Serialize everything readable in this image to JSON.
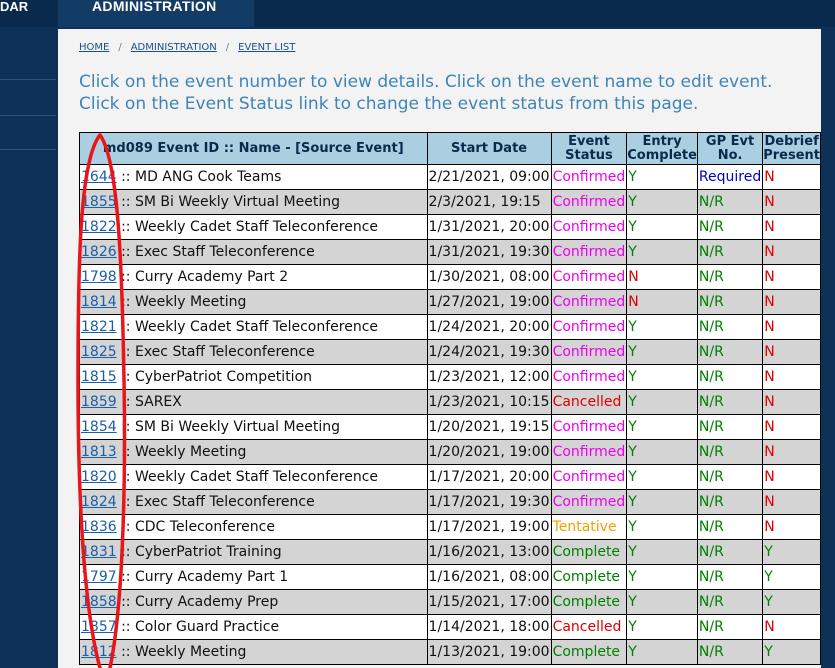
{
  "nav": {
    "item1": "DAR",
    "item2": "ADMINISTRATION"
  },
  "breadcrumb": {
    "home": "HOME",
    "sep": "/",
    "admin": "ADMINISTRATION",
    "list": "EVENT LIST"
  },
  "intro": "Click on the event number to view details. Click on the event name to edit event. Click on the Event Status link to change the event status from this page.",
  "table": {
    "headers": {
      "name": "md089 Event ID :: Name - [Source Event]",
      "start": "Start Date",
      "status_l1": "Event",
      "status_l2": "Status",
      "entry_l1": "Entry",
      "entry_l2": "Complete",
      "gp_l1": "GP Evt",
      "gp_l2": "No.",
      "debrief_l1": "Debrief",
      "debrief_l2": "Present"
    },
    "rows": [
      {
        "id": "1644",
        "name": "MD ANG Cook Teams",
        "start": "2/21/2021, 09:00",
        "status": "Confirmed",
        "entry": "Y",
        "gp": "Required",
        "debrief": "N"
      },
      {
        "id": "1855",
        "name": "SM Bi Weekly Virtual Meeting",
        "start": "2/3/2021, 19:15",
        "status": "Confirmed",
        "entry": "Y",
        "gp": "N/R",
        "debrief": "N"
      },
      {
        "id": "1822",
        "name": "Weekly Cadet Staff Teleconference",
        "start": "1/31/2021, 20:00",
        "status": "Confirmed",
        "entry": "Y",
        "gp": "N/R",
        "debrief": "N"
      },
      {
        "id": "1826",
        "name": "Exec Staff Teleconference",
        "start": "1/31/2021, 19:30",
        "status": "Confirmed",
        "entry": "Y",
        "gp": "N/R",
        "debrief": "N"
      },
      {
        "id": "1798",
        "name": "Curry Academy Part 2",
        "start": "1/30/2021, 08:00",
        "status": "Confirmed",
        "entry": "N",
        "gp": "N/R",
        "debrief": "N"
      },
      {
        "id": "1814",
        "name": "Weekly Meeting",
        "start": "1/27/2021, 19:00",
        "status": "Confirmed",
        "entry": "N",
        "gp": "N/R",
        "debrief": "N"
      },
      {
        "id": "1821",
        "name": "Weekly Cadet Staff Teleconference",
        "start": "1/24/2021, 20:00",
        "status": "Confirmed",
        "entry": "Y",
        "gp": "N/R",
        "debrief": "N"
      },
      {
        "id": "1825",
        "name": "Exec Staff Teleconference",
        "start": "1/24/2021, 19:30",
        "status": "Confirmed",
        "entry": "Y",
        "gp": "N/R",
        "debrief": "N"
      },
      {
        "id": "1815",
        "name": "CyberPatriot Competition",
        "start": "1/23/2021, 12:00",
        "status": "Confirmed",
        "entry": "Y",
        "gp": "N/R",
        "debrief": "N"
      },
      {
        "id": "1859",
        "name": "SAREX",
        "start": "1/23/2021, 10:15",
        "status": "Cancelled",
        "entry": "Y",
        "gp": "N/R",
        "debrief": "N"
      },
      {
        "id": "1854",
        "name": "SM Bi Weekly Virtual Meeting",
        "start": "1/20/2021, 19:15",
        "status": "Confirmed",
        "entry": "Y",
        "gp": "N/R",
        "debrief": "N"
      },
      {
        "id": "1813",
        "name": "Weekly Meeting",
        "start": "1/20/2021, 19:00",
        "status": "Confirmed",
        "entry": "Y",
        "gp": "N/R",
        "debrief": "N"
      },
      {
        "id": "1820",
        "name": "Weekly Cadet Staff Teleconference",
        "start": "1/17/2021, 20:00",
        "status": "Confirmed",
        "entry": "Y",
        "gp": "N/R",
        "debrief": "N"
      },
      {
        "id": "1824",
        "name": "Exec Staff Teleconference",
        "start": "1/17/2021, 19:30",
        "status": "Confirmed",
        "entry": "Y",
        "gp": "N/R",
        "debrief": "N"
      },
      {
        "id": "1836",
        "name": "CDC Teleconference",
        "start": "1/17/2021, 19:00",
        "status": "Tentative",
        "entry": "Y",
        "gp": "N/R",
        "debrief": "N"
      },
      {
        "id": "1831",
        "name": "CyberPatriot Training",
        "start": "1/16/2021, 13:00",
        "status": "Complete",
        "entry": "Y",
        "gp": "N/R",
        "debrief": "Y"
      },
      {
        "id": "1797",
        "name": "Curry Academy Part 1",
        "start": "1/16/2021, 08:00",
        "status": "Complete",
        "entry": "Y",
        "gp": "N/R",
        "debrief": "Y"
      },
      {
        "id": "1858",
        "name": "Curry Academy Prep",
        "start": "1/15/2021, 17:00",
        "status": "Complete",
        "entry": "Y",
        "gp": "N/R",
        "debrief": "Y"
      },
      {
        "id": "1857",
        "name": "Color Guard Practice",
        "start": "1/14/2021, 18:00",
        "status": "Cancelled",
        "entry": "Y",
        "gp": "N/R",
        "debrief": "N"
      },
      {
        "id": "1812",
        "name": "Weekly Meeting",
        "start": "1/13/2021, 19:00",
        "status": "Complete",
        "entry": "Y",
        "gp": "N/R",
        "debrief": "Y"
      }
    ]
  },
  "colors": {
    "confirmed": "#ee00ee",
    "cancelled": "#dd0000",
    "tentative": "#f0a000",
    "complete": "#008000",
    "header_bg": "#a9cfe0",
    "nav_bg": "#0a2a4d",
    "annotation": "#e8161b"
  }
}
